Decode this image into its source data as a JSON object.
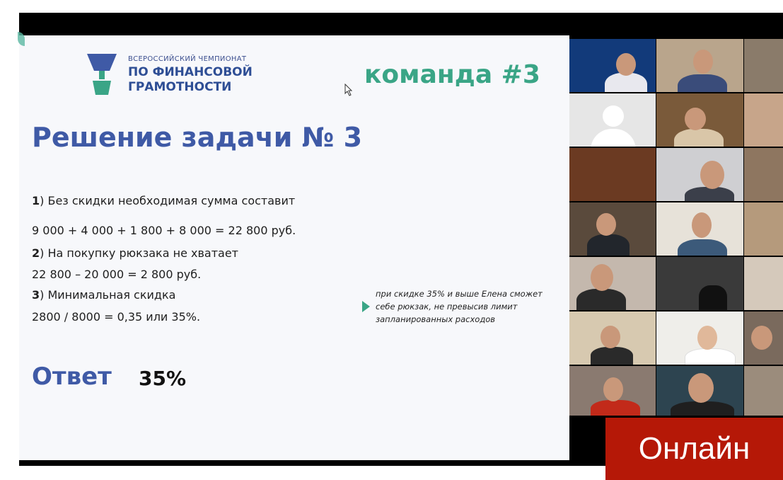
{
  "slide": {
    "logo_line1": "ВСЕРОССИЙСКИЙ ЧЕМПИОНАТ",
    "logo_line2": "ПО ФИНАНСОВОЙ",
    "logo_line3": "ГРАМОТНОСТИ",
    "team": "команда #3",
    "title": "Решение задачи № 3",
    "steps": [
      {
        "num": "1",
        "text": ") Без скидки необходимая сумма составит"
      },
      {
        "calc": "9 000 + 4 000 + 1 800 + 8 000 = 22 800 руб."
      },
      {
        "num": "2",
        "text": ") На покупку рюкзака не хватает"
      },
      {
        "calc": "22 800 – 20 000 = 2 800 руб."
      },
      {
        "num": "3",
        "text": ") Минимальная скидка"
      },
      {
        "calc": "2800 / 8000 = 0,35 или 35%."
      }
    ],
    "note_lines": [
      "при скидке 35% и выше Елена сможет",
      "себе рюкзак, не превысив лимит",
      "запланированных расходов"
    ],
    "answer_label": "Ответ",
    "answer_value": "35%"
  },
  "overlay": {
    "online_label": "Онлайн"
  },
  "colors": {
    "accent_green": "#3aa586",
    "title_blue": "#3f5aa6",
    "online_red": "#b51807"
  },
  "participants_count": 20
}
